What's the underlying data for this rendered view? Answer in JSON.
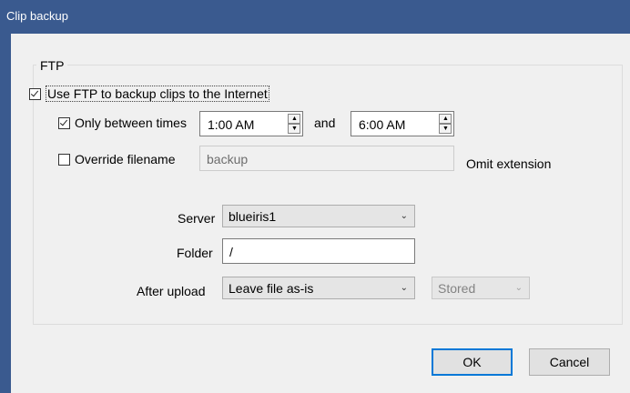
{
  "window": {
    "title": "Clip backup"
  },
  "group": {
    "label": "FTP"
  },
  "use_ftp": {
    "label": "Use FTP to backup clips to the Internet",
    "checked": true
  },
  "between_times": {
    "label": "Only between times",
    "checked": true,
    "start": "1:00 AM",
    "and_label": "and",
    "end": "6:00 AM"
  },
  "override": {
    "label": "Override filename",
    "checked": false,
    "value": "backup",
    "omit_label": "Omit extension"
  },
  "server": {
    "label": "Server",
    "value": "blueiris1"
  },
  "folder": {
    "label": "Folder",
    "value": "/"
  },
  "after_upload": {
    "label": "After upload",
    "value": "Leave file as-is",
    "secondary_value": "Stored"
  },
  "buttons": {
    "ok": "OK",
    "cancel": "Cancel"
  },
  "icons": {
    "spin_up": "up-arrow",
    "spin_down": "down-arrow",
    "dropdown": "chevron-down"
  }
}
